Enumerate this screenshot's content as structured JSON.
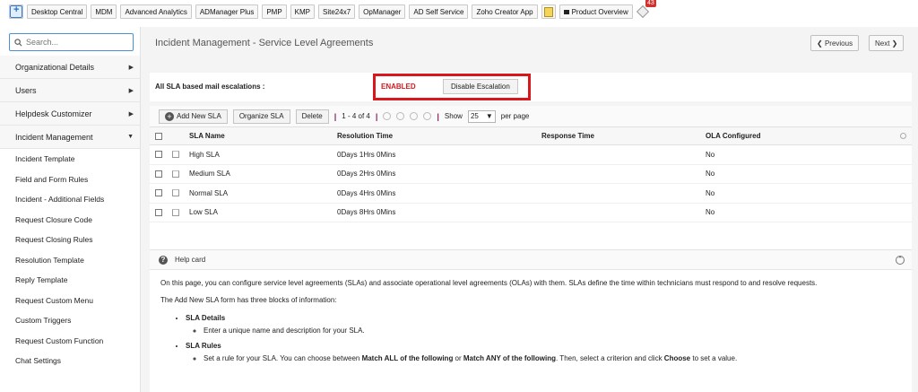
{
  "toolbar": {
    "items": [
      "Desktop Central",
      "MDM",
      "Advanced Analytics",
      "ADManager Plus",
      "PMP",
      "KMP",
      "Site24x7",
      "OpManager",
      "AD Self Service",
      "Zoho Creator App"
    ],
    "product_overview": "Product Overview",
    "notification_count": "43"
  },
  "sidebar": {
    "search_placeholder": "Search...",
    "groups": [
      "Organizational Details",
      "Users",
      "Helpdesk Customizer",
      "Incident Management"
    ],
    "incident_items": [
      "Incident Template",
      "Field and Form Rules",
      "Incident - Additional Fields",
      "Request Closure Code",
      "Request Closing Rules",
      "Resolution Template",
      "Reply Template",
      "Request Custom Menu",
      "Custom Triggers",
      "Request Custom Function",
      "Chat Settings"
    ]
  },
  "header": {
    "title": "Incident Management - Service Level Agreements",
    "previous": "Previous",
    "next": "Next"
  },
  "escalation": {
    "label": "All SLA based mail escalations :",
    "status": "ENABLED",
    "button": "Disable Escalation"
  },
  "table_toolbar": {
    "add": "Add New SLA",
    "organize": "Organize SLA",
    "delete": "Delete",
    "range": "1 - 4 of 4",
    "show": "Show",
    "per_page_value": "25",
    "per_page": "per page"
  },
  "table": {
    "columns": [
      "SLA Name",
      "Resolution Time",
      "Response Time",
      "OLA Configured"
    ],
    "rows": [
      {
        "name": "High SLA",
        "resolution": "0Days 1Hrs 0Mins",
        "response": "",
        "ola": "No"
      },
      {
        "name": "Medium SLA",
        "resolution": "0Days 2Hrs 0Mins",
        "response": "",
        "ola": "No"
      },
      {
        "name": "Normal SLA",
        "resolution": "0Days 4Hrs 0Mins",
        "response": "",
        "ola": "No"
      },
      {
        "name": "Low SLA",
        "resolution": "0Days 8Hrs 0Mins",
        "response": "",
        "ola": "No"
      }
    ]
  },
  "help": {
    "title": "Help card",
    "intro": "On this page, you can configure service level agreements (SLAs) and associate operational level agreements (OLAs) with them. SLAs define the time within technicians must respond to and resolve requests.",
    "blocks_intro": "The Add New SLA form has three blocks of information:",
    "block1_title": "SLA Details",
    "block1_sub": "Enter a unique name and description for your SLA.",
    "block2_title": "SLA Rules",
    "block2_sub_a": "Set a rule for your SLA. You can choose between ",
    "block2_sub_b": "Match ALL of the following",
    "block2_sub_c": " or ",
    "block2_sub_d": "Match ANY of the following",
    "block2_sub_e": ". Then, select a criterion and click ",
    "block2_sub_f": "Choose",
    "block2_sub_g": " to set a value."
  }
}
